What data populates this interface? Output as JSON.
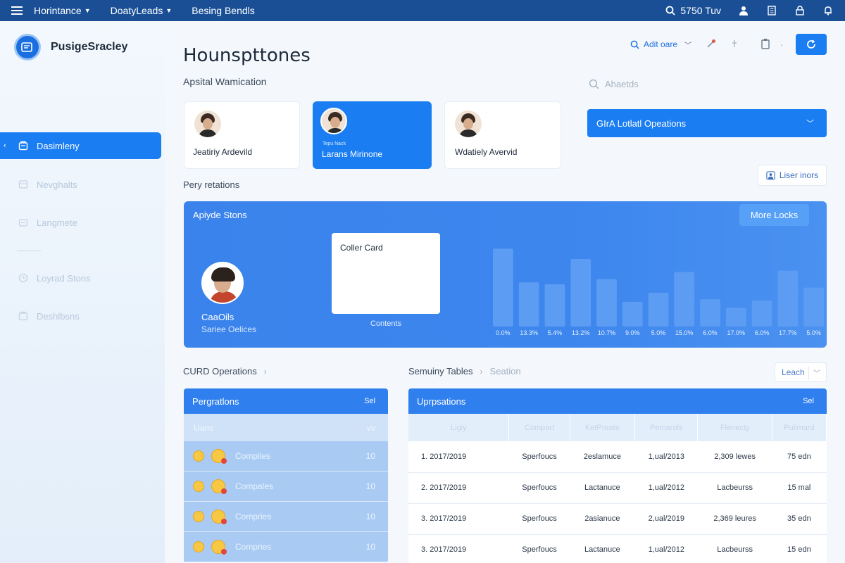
{
  "topbar": {
    "nav": [
      {
        "label": "Horintance",
        "has_caret": true
      },
      {
        "label": "DoatyLeads",
        "has_caret": true
      },
      {
        "label": "Besing Bendls",
        "has_caret": false
      }
    ],
    "search_value": "5750 Tuv",
    "icons": [
      "search-icon",
      "user-icon",
      "building-icon",
      "lock-icon",
      "bell-icon"
    ]
  },
  "sidebar": {
    "brand": "PusigeSracley",
    "items": [
      {
        "label": "Dasimleny",
        "icon": "dashboard-icon",
        "active": true
      },
      {
        "label": "Nevghalts",
        "icon": "grid-icon",
        "active": false
      },
      {
        "label": "Langmete",
        "icon": "layers-icon",
        "active": false
      },
      {
        "label": "Loyrad Stons",
        "icon": "clock-icon",
        "active": false
      },
      {
        "label": "Deshlbsns",
        "icon": "folder-icon",
        "active": false
      }
    ]
  },
  "header": {
    "title": "Hounspttones",
    "subtitle": "Apsital Wamication",
    "auth_label": "Adit oare",
    "search_placeholder": "Ahaetds"
  },
  "people": [
    {
      "name": "Jeatiriy Ardevild",
      "selected": false
    },
    {
      "name": "Larans Mirinone",
      "small": "Tepu Nack",
      "selected": true
    },
    {
      "name": "Wdatiely Avervid",
      "selected": false
    }
  ],
  "ops_select": {
    "value": "GIrA Lotlatl Opeations"
  },
  "user_button": "Liser inors",
  "section_label": "Pery retations",
  "banner": {
    "title": "Apiyde Stons",
    "more_button": "More Locks",
    "person_name": "CaaOils",
    "person_role": "Sariee Oelices",
    "card_title": "Coller Card",
    "contents_label": "Contents"
  },
  "chart_data": {
    "type": "bar",
    "categories": [
      "0.0%",
      "13.3%",
      "5.4%",
      "13.2%",
      "10.7%",
      "9.0%",
      "5.0%",
      "15.0%",
      "6.0%",
      "17.0%",
      "6.0%",
      "17.7%",
      "5.0%"
    ],
    "values": [
      120,
      68,
      65,
      104,
      73,
      38,
      52,
      84,
      42,
      29,
      40,
      86,
      60
    ],
    "ylim": [
      0,
      130
    ],
    "color": "#5c9df3"
  },
  "crud": {
    "label": "CURD Operations",
    "panel_title": "Pergratlons",
    "panel_small": "Sel",
    "sub_left": "Uans",
    "sub_right": "vv",
    "rows": [
      {
        "label": "Compiles",
        "value": "10"
      },
      {
        "label": "Compales",
        "value": "10"
      },
      {
        "label": "Compries",
        "value": "10"
      },
      {
        "label": "Compries",
        "value": "10"
      }
    ]
  },
  "tables": {
    "crumb": "Semuiny Tables",
    "crumb_muted": "Seation",
    "select_value": "Leach",
    "panel_title": "Uprpsations",
    "panel_small": "Sel",
    "columns": [
      "Ligiy",
      "Compart",
      "KetPreate",
      "Pemarols",
      "Flenecty",
      "Pulimard"
    ],
    "rows": [
      [
        "1. 2017/2019",
        "Sperfoucs",
        "2eslamuce",
        "1,ual/2013",
        "2,309 lewes",
        "75 edn"
      ],
      [
        "2. 2017/2019",
        "Sperfoucs",
        "Lactanuce",
        "1,ual/2012",
        "Lacbeurss",
        "15 mal"
      ],
      [
        "3. 2017/2019",
        "Sperfoucs",
        "2asianuce",
        "2,ual/2019",
        "2,369 leures",
        "35 edn"
      ],
      [
        "3. 2017/2019",
        "Sperfoucs",
        "Lactanuce",
        "1,ual/2012",
        "Lacbeurss",
        "15 edn"
      ]
    ]
  }
}
